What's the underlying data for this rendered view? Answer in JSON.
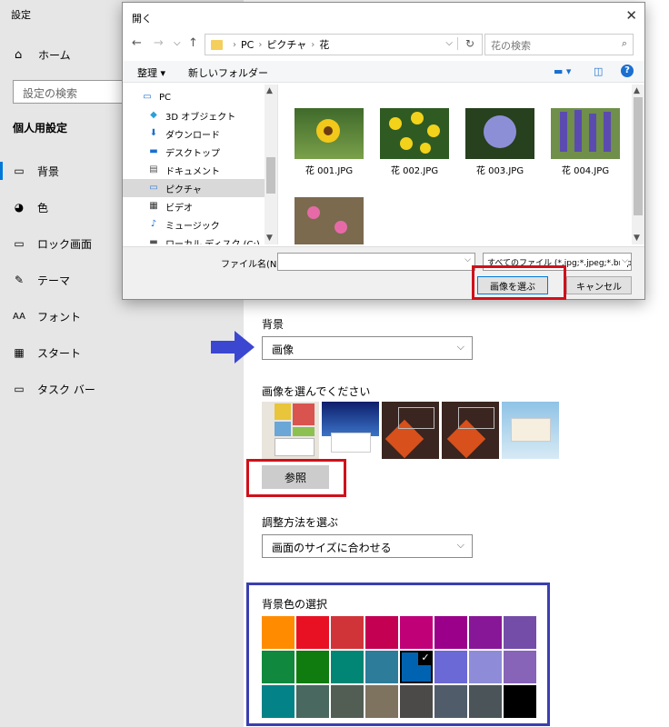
{
  "settings": {
    "app_title": "設定",
    "home_label": "ホーム",
    "search_placeholder": "設定の検索",
    "section_title": "個人用設定",
    "nav_items": [
      {
        "label": "背景",
        "icon": "image-icon"
      },
      {
        "label": "色",
        "icon": "palette-icon"
      },
      {
        "label": "ロック画面",
        "icon": "lock-screen-icon"
      },
      {
        "label": "テーマ",
        "icon": "theme-icon"
      },
      {
        "label": "フォント",
        "icon": "font-icon"
      },
      {
        "label": "スタート",
        "icon": "start-icon"
      },
      {
        "label": "タスク バー",
        "icon": "taskbar-icon"
      }
    ],
    "selected_nav": "背景"
  },
  "main": {
    "background_label": "背景",
    "background_value": "画像",
    "choose_picture_label": "画像を選んでください",
    "browse_label": "参照",
    "fit_label": "調整方法を選ぶ",
    "fit_value": "画面のサイズに合わせる",
    "bg_color_label": "背景色の選択",
    "colors": [
      "#ff8c00",
      "#e81123",
      "#d13438",
      "#c30052",
      "#bf0077",
      "#9a0089",
      "#881798",
      "#744da9",
      "#10893e",
      "#107c10",
      "#018574",
      "#2d7d9a",
      "#0063b1",
      "#6b69d6",
      "#8e8cd8",
      "#8764b8",
      "#038387",
      "#486860",
      "#525e54",
      "#7e735f",
      "#4c4a48",
      "#515c6b",
      "#4a5459",
      "#000000"
    ],
    "selected_color_index": 12,
    "highlight_red": "#d0101a",
    "highlight_blue": "#3a3fb0",
    "arrow_color": "#3b47d1"
  },
  "dialog": {
    "title": "開く",
    "path": [
      "PC",
      "ピクチャ",
      "花"
    ],
    "search_placeholder": "花の検索",
    "organize_label": "整理 ▾",
    "new_folder_label": "新しいフォルダー",
    "tree": [
      {
        "label": "PC",
        "icon": "pc-icon"
      },
      {
        "label": "3D オブジェクト",
        "icon": "3d-objects-icon"
      },
      {
        "label": "ダウンロード",
        "icon": "download-icon"
      },
      {
        "label": "デスクトップ",
        "icon": "desktop-icon"
      },
      {
        "label": "ドキュメント",
        "icon": "document-icon"
      },
      {
        "label": "ピクチャ",
        "icon": "pictures-icon"
      },
      {
        "label": "ビデオ",
        "icon": "video-icon"
      },
      {
        "label": "ミュージック",
        "icon": "music-icon"
      },
      {
        "label": "ローカル ディスク (C:)",
        "icon": "disk-icon"
      }
    ],
    "selected_tree": "ピクチャ",
    "files": [
      {
        "name": "花 001.JPG"
      },
      {
        "name": "花 002.JPG"
      },
      {
        "name": "花 003.JPG"
      },
      {
        "name": "花 004.JPG"
      },
      {
        "name": ""
      }
    ],
    "filename_label": "ファイル名(N):",
    "filename_value": "",
    "filetype_value": "すべてのファイル (*.jpg;*.jpeg;*.bmp",
    "choose_button": "画像を選ぶ",
    "cancel_button": "キャンセル"
  }
}
